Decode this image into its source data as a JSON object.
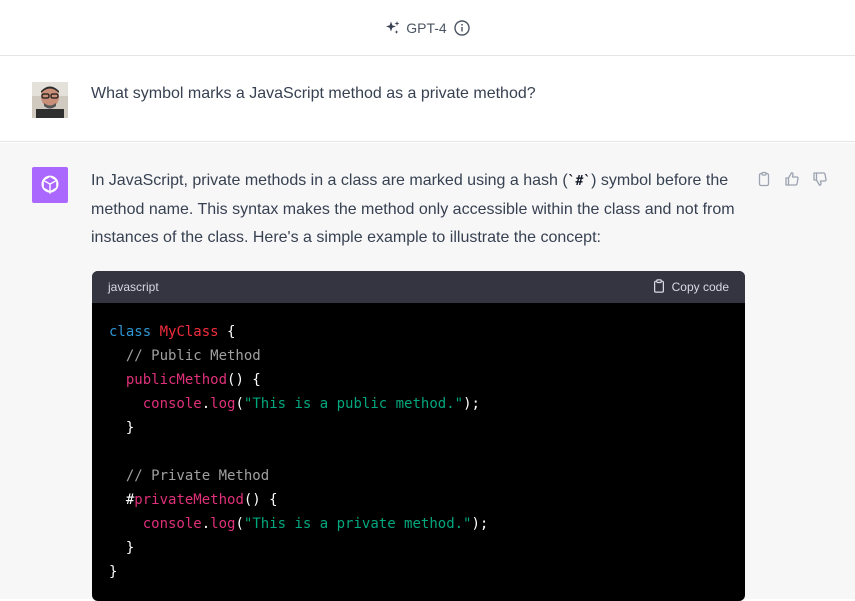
{
  "header": {
    "model_label": "GPT-4",
    "icons": [
      "sparkle-icon",
      "info-icon"
    ]
  },
  "user_message": {
    "text": "What symbol marks a JavaScript method as a private method?"
  },
  "assistant_message": {
    "para_part1": "In JavaScript, private methods in a class are marked using a hash (",
    "para_code": "`#`",
    "para_part2": ") symbol before the method name. This syntax makes the method only accessible within the class and not from instances of the class. Here's a simple example to illustrate the concept:",
    "actions": [
      "copy-icon",
      "thumbs-up-icon",
      "thumbs-down-icon"
    ]
  },
  "code_block": {
    "language": "javascript",
    "copy_label": "Copy code",
    "lines": {
      "l1_kw": "class",
      "l1_cls": "MyClass",
      "l1_rest": " {",
      "l2": "// Public Method",
      "l3_fn": "publicMethod",
      "l3_rest": "() {",
      "l4_obj": "console",
      "l4_dot": ".",
      "l4_fn": "log",
      "l4_open": "(",
      "l4_str": "\"This is a public method.\"",
      "l4_close": ");",
      "l5": "}",
      "l7": "// Private Method",
      "l8_hash": "#",
      "l8_fn": "privateMethod",
      "l8_rest": "() {",
      "l9_obj": "console",
      "l9_dot": ".",
      "l9_fn": "log",
      "l9_open": "(",
      "l9_str": "\"This is a private method.\"",
      "l9_close": ");",
      "l10": "}",
      "l11": "}"
    }
  }
}
